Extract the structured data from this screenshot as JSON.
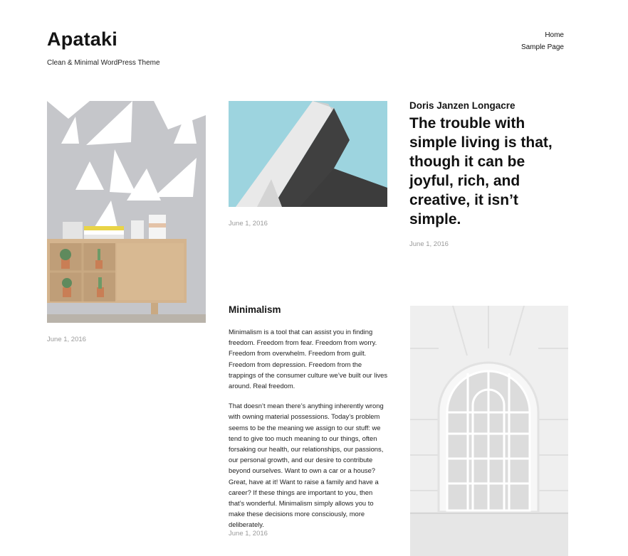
{
  "site": {
    "title": "Apataki",
    "description": "Clean & Minimal WordPress Theme"
  },
  "nav": {
    "items": [
      "Home",
      "Sample Page"
    ]
  },
  "posts": {
    "shelf": {
      "date": "June 1, 2016",
      "image": "minimal-shelf-photo"
    },
    "architecture": {
      "date": "June 1, 2016",
      "image": "abstract-architecture-photo"
    },
    "quote": {
      "author": "Doris Janzen Longacre",
      "text": "The trouble with simple living is that, though it can be joyful, rich, and creative, it isn’t simple.",
      "date": "June 1, 2016"
    },
    "minimalism": {
      "title": "Minimalism",
      "paragraphs": [
        "Minimalism is a tool that can assist you in finding freedom. Freedom from fear. Freedom from worry. Freedom from overwhelm. Freedom from guilt. Freedom from depression. Freedom from the trappings of the consumer culture we’ve built our lives around. Real freedom.",
        "That doesn’t mean there’s anything inherently wrong with owning material possessions. Today’s problem seems to be the meaning we assign to our stuff: we tend to give too much meaning to our things, often forsaking our health, our relationships, our passions, our personal growth, and our desire to contribute beyond ourselves. Want to own a car or a house? Great, have at it! Want to raise a family and have a career? If these things are important to you, then that’s wonderful. Minimalism simply allows you to make these decisions more consciously, more deliberately."
      ],
      "date": "June 1, 2016"
    },
    "window": {
      "image": "arched-window-photo"
    }
  },
  "colors": {
    "text": "#111111",
    "date": "#9a9a9a",
    "sky": "#9dd3df"
  }
}
